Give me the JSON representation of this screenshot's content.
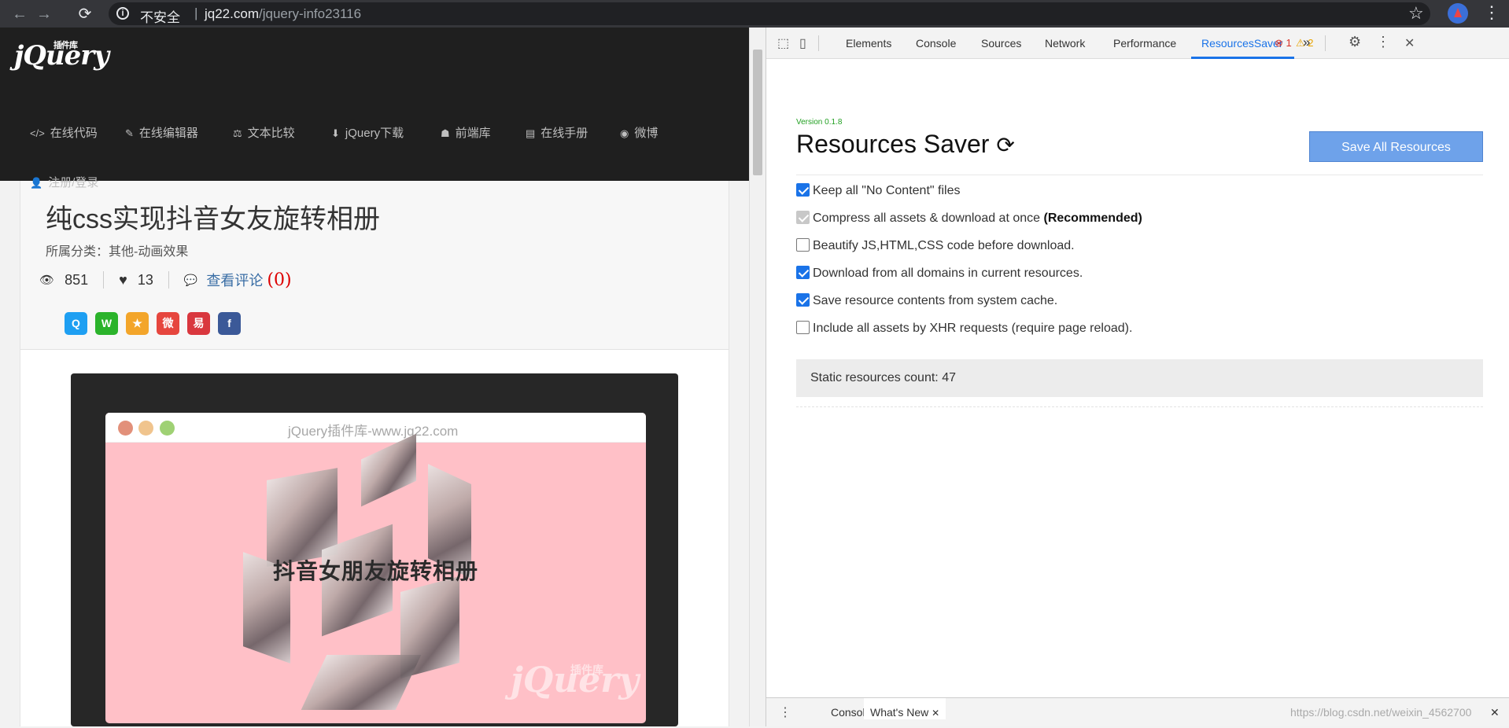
{
  "browser": {
    "back_glyph": "←",
    "forward_glyph": "→",
    "reload_glyph": "⟳",
    "security_label": "不安全",
    "separator": "|",
    "url_host": "jq22.com",
    "url_path": "/jquery-info23116",
    "star_glyph": "☆",
    "menu_glyph": "⋮"
  },
  "site": {
    "logo_text": "jQuery",
    "logo_badge": "插件库",
    "nav": [
      {
        "icon": "</>",
        "label": "在线代码"
      },
      {
        "icon": "✎",
        "label": "在线编辑器"
      },
      {
        "icon": "⚖",
        "label": "文本比较"
      },
      {
        "icon": "⬇",
        "label": "jQuery下载"
      },
      {
        "icon": "☗",
        "label": "前端库"
      },
      {
        "icon": "▤",
        "label": "在线手册"
      },
      {
        "icon": "◉",
        "label": "微博"
      },
      {
        "icon": "👤",
        "label": "注册/登录"
      }
    ]
  },
  "article": {
    "title": "纯css实现抖音女友旋转相册",
    "category": "所属分类：其他-动画效果",
    "views": "851",
    "likes": "13",
    "comment_label": "查看评论",
    "comment_count": "(0)",
    "eye_glyph": "👁",
    "heart_glyph": "♥",
    "comment_glyph": "💬",
    "share": [
      {
        "name": "qq",
        "glyph": "Q",
        "color": "#1e9ff2"
      },
      {
        "name": "wechat",
        "glyph": "W",
        "color": "#2bb32b"
      },
      {
        "name": "qzone",
        "glyph": "★",
        "color": "#f3a52a"
      },
      {
        "name": "weibo",
        "glyph": "微",
        "color": "#e6463e"
      },
      {
        "name": "netease",
        "glyph": "易",
        "color": "#d9373e"
      },
      {
        "name": "facebook",
        "glyph": "f",
        "color": "#3b5998"
      }
    ]
  },
  "demo": {
    "window_title": "jQuery插件库-www.jq22.com",
    "caption": "抖音女朋友旋转相册",
    "watermark": "jQuery",
    "watermark_badge": "插件库",
    "dot_colors": [
      "#e2907a",
      "#f0c48d",
      "#9fd174"
    ]
  },
  "devtools": {
    "tabs": [
      "Elements",
      "Console",
      "Sources",
      "Network",
      "Performance",
      "ResourcesSaver"
    ],
    "active_tab": "ResourcesSaver",
    "more_glyph": "»",
    "errors": "1",
    "warnings": "2",
    "error_glyph": "⊗",
    "warning_glyph": "⚠",
    "gear_glyph": "⚙",
    "kebab_glyph": "⋮",
    "close_glyph": "✕",
    "inspect_glyph": "⬚",
    "device_glyph": "▯",
    "accent_color": "#1a73e8"
  },
  "resources_saver": {
    "version": "Version 0.1.8",
    "title": "Resources Saver",
    "refresh_glyph": "⟳",
    "save_button": "Save All Resources",
    "options": [
      {
        "label": "Keep all \"No Content\" files",
        "checked": true,
        "disabled": false,
        "suffix": ""
      },
      {
        "label": "Compress all assets & download at once",
        "checked": true,
        "disabled": true,
        "suffix": "(Recommended)"
      },
      {
        "label": "Beautify JS,HTML,CSS code before download.",
        "checked": false,
        "disabled": false,
        "suffix": ""
      },
      {
        "label": "Download from all domains in current resources.",
        "checked": true,
        "disabled": false,
        "suffix": ""
      },
      {
        "label": "Save resource contents from system cache.",
        "checked": true,
        "disabled": false,
        "suffix": ""
      },
      {
        "label": "Include all assets by XHR requests (require page reload).",
        "checked": false,
        "disabled": false,
        "suffix": ""
      }
    ],
    "static_count": "Static resources count: 47"
  },
  "drawer": {
    "tabs": [
      "Console",
      "What's New"
    ],
    "active_tab": "What's New",
    "close_glyph": "✕",
    "kebab_glyph": "⋮"
  },
  "watermark_text": "https://blog.csdn.net/weixin_4562700"
}
